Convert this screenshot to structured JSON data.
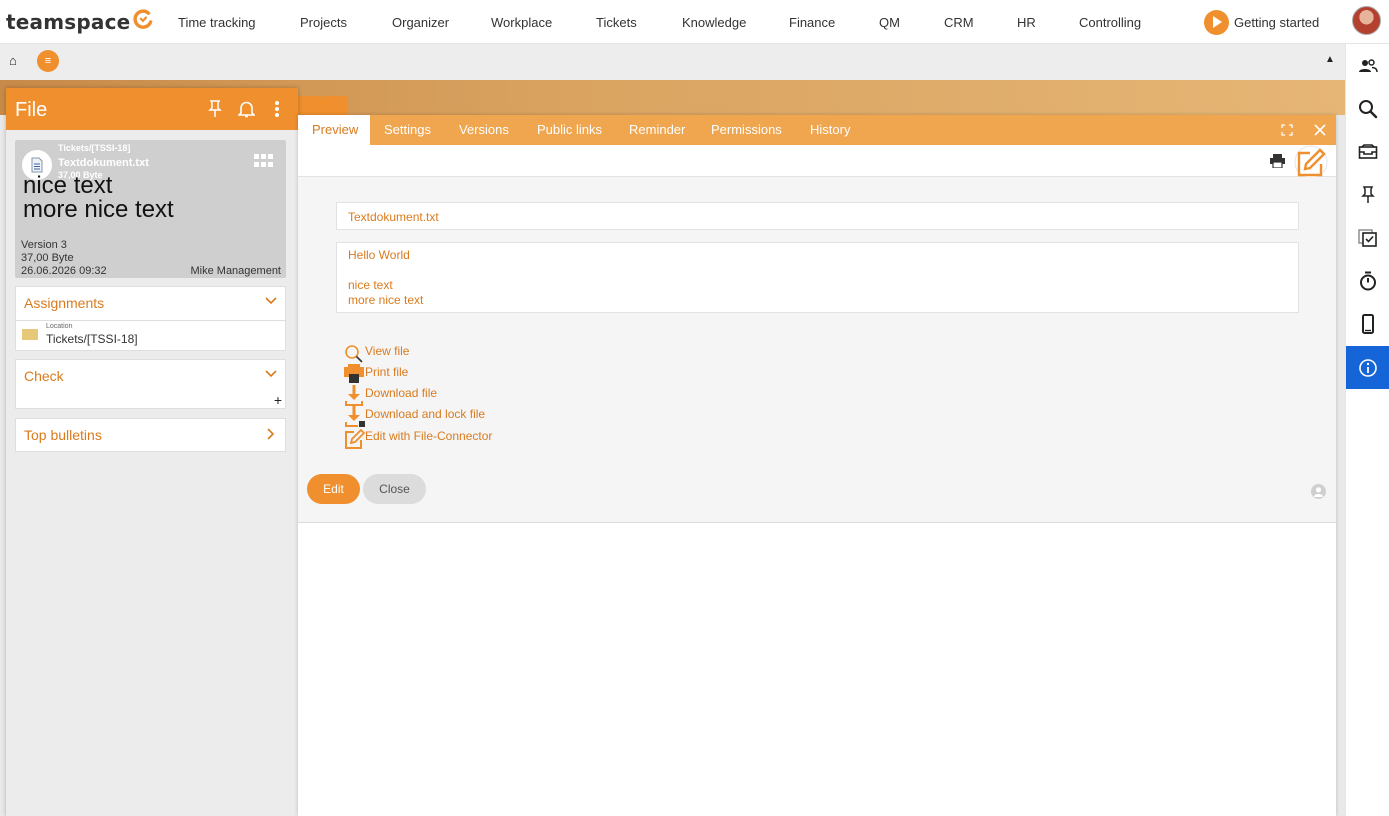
{
  "app": {
    "logo_text": "teamspace",
    "brand_color": "#ef8f2e",
    "active_color": "#1565d8"
  },
  "nav": {
    "items": [
      "Time tracking",
      "Projects",
      "Organizer",
      "Workplace",
      "Tickets",
      "Knowledge",
      "Finance",
      "QM",
      "CRM",
      "HR",
      "Controlling"
    ],
    "getting_started": "Getting started"
  },
  "subbar": {
    "home_icon": "home-icon",
    "menu_icon": "menu-icon",
    "collapse_icon": "collapse-up-icon"
  },
  "rail": {
    "icons": [
      "users-icon",
      "search-icon",
      "inbox-icon",
      "pin-icon",
      "tasks-icon",
      "stopwatch-icon",
      "mobile-icon",
      "info-icon"
    ],
    "active": "info-icon"
  },
  "file_panel": {
    "title": "File",
    "card": {
      "path": "Tickets/[TSSI-18]",
      "name": "Textdokument.txt",
      "size_small": "37,00 Byte",
      "overlay_text": "nice text\nmore nice text",
      "version": "Version 3",
      "size": "37,00 Byte",
      "date": "26.06.2026 09:32",
      "owner": "Mike Management"
    },
    "assignments": {
      "title": "Assignments",
      "location_label": "Location",
      "location_value": "Tickets/[TSSI-18]"
    },
    "check": {
      "title": "Check",
      "add": "+"
    },
    "top_bulletins": {
      "title": "Top bulletins"
    }
  },
  "main": {
    "tabs": [
      "Preview",
      "Settings",
      "Versions",
      "Public links",
      "Reminder",
      "Permissions",
      "History"
    ],
    "active_tab": "Preview",
    "filename": "Textdokument.txt",
    "body_lines": [
      "Hello World",
      "",
      "nice text",
      "more nice text"
    ],
    "actions": [
      "View file",
      "Print file",
      "Download file",
      "Download and lock file",
      "Edit with File-Connector"
    ],
    "edit_button": "Edit",
    "close_button": "Close"
  }
}
